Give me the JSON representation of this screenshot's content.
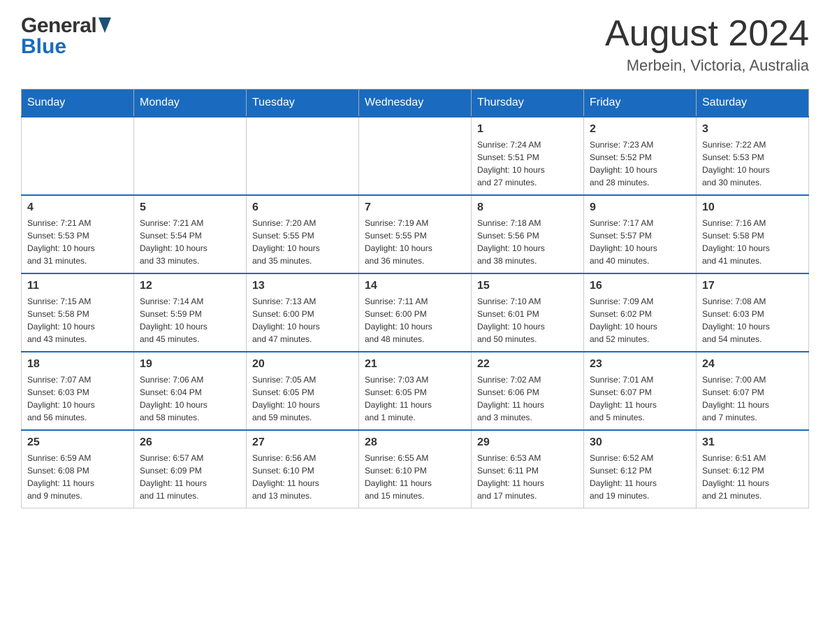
{
  "header": {
    "logo_general": "General",
    "logo_blue": "Blue",
    "title": "August 2024",
    "location": "Merbein, Victoria, Australia"
  },
  "days_of_week": [
    "Sunday",
    "Monday",
    "Tuesday",
    "Wednesday",
    "Thursday",
    "Friday",
    "Saturday"
  ],
  "weeks": [
    [
      {
        "day": "",
        "info": ""
      },
      {
        "day": "",
        "info": ""
      },
      {
        "day": "",
        "info": ""
      },
      {
        "day": "",
        "info": ""
      },
      {
        "day": "1",
        "info": "Sunrise: 7:24 AM\nSunset: 5:51 PM\nDaylight: 10 hours\nand 27 minutes."
      },
      {
        "day": "2",
        "info": "Sunrise: 7:23 AM\nSunset: 5:52 PM\nDaylight: 10 hours\nand 28 minutes."
      },
      {
        "day": "3",
        "info": "Sunrise: 7:22 AM\nSunset: 5:53 PM\nDaylight: 10 hours\nand 30 minutes."
      }
    ],
    [
      {
        "day": "4",
        "info": "Sunrise: 7:21 AM\nSunset: 5:53 PM\nDaylight: 10 hours\nand 31 minutes."
      },
      {
        "day": "5",
        "info": "Sunrise: 7:21 AM\nSunset: 5:54 PM\nDaylight: 10 hours\nand 33 minutes."
      },
      {
        "day": "6",
        "info": "Sunrise: 7:20 AM\nSunset: 5:55 PM\nDaylight: 10 hours\nand 35 minutes."
      },
      {
        "day": "7",
        "info": "Sunrise: 7:19 AM\nSunset: 5:55 PM\nDaylight: 10 hours\nand 36 minutes."
      },
      {
        "day": "8",
        "info": "Sunrise: 7:18 AM\nSunset: 5:56 PM\nDaylight: 10 hours\nand 38 minutes."
      },
      {
        "day": "9",
        "info": "Sunrise: 7:17 AM\nSunset: 5:57 PM\nDaylight: 10 hours\nand 40 minutes."
      },
      {
        "day": "10",
        "info": "Sunrise: 7:16 AM\nSunset: 5:58 PM\nDaylight: 10 hours\nand 41 minutes."
      }
    ],
    [
      {
        "day": "11",
        "info": "Sunrise: 7:15 AM\nSunset: 5:58 PM\nDaylight: 10 hours\nand 43 minutes."
      },
      {
        "day": "12",
        "info": "Sunrise: 7:14 AM\nSunset: 5:59 PM\nDaylight: 10 hours\nand 45 minutes."
      },
      {
        "day": "13",
        "info": "Sunrise: 7:13 AM\nSunset: 6:00 PM\nDaylight: 10 hours\nand 47 minutes."
      },
      {
        "day": "14",
        "info": "Sunrise: 7:11 AM\nSunset: 6:00 PM\nDaylight: 10 hours\nand 48 minutes."
      },
      {
        "day": "15",
        "info": "Sunrise: 7:10 AM\nSunset: 6:01 PM\nDaylight: 10 hours\nand 50 minutes."
      },
      {
        "day": "16",
        "info": "Sunrise: 7:09 AM\nSunset: 6:02 PM\nDaylight: 10 hours\nand 52 minutes."
      },
      {
        "day": "17",
        "info": "Sunrise: 7:08 AM\nSunset: 6:03 PM\nDaylight: 10 hours\nand 54 minutes."
      }
    ],
    [
      {
        "day": "18",
        "info": "Sunrise: 7:07 AM\nSunset: 6:03 PM\nDaylight: 10 hours\nand 56 minutes."
      },
      {
        "day": "19",
        "info": "Sunrise: 7:06 AM\nSunset: 6:04 PM\nDaylight: 10 hours\nand 58 minutes."
      },
      {
        "day": "20",
        "info": "Sunrise: 7:05 AM\nSunset: 6:05 PM\nDaylight: 10 hours\nand 59 minutes."
      },
      {
        "day": "21",
        "info": "Sunrise: 7:03 AM\nSunset: 6:05 PM\nDaylight: 11 hours\nand 1 minute."
      },
      {
        "day": "22",
        "info": "Sunrise: 7:02 AM\nSunset: 6:06 PM\nDaylight: 11 hours\nand 3 minutes."
      },
      {
        "day": "23",
        "info": "Sunrise: 7:01 AM\nSunset: 6:07 PM\nDaylight: 11 hours\nand 5 minutes."
      },
      {
        "day": "24",
        "info": "Sunrise: 7:00 AM\nSunset: 6:07 PM\nDaylight: 11 hours\nand 7 minutes."
      }
    ],
    [
      {
        "day": "25",
        "info": "Sunrise: 6:59 AM\nSunset: 6:08 PM\nDaylight: 11 hours\nand 9 minutes."
      },
      {
        "day": "26",
        "info": "Sunrise: 6:57 AM\nSunset: 6:09 PM\nDaylight: 11 hours\nand 11 minutes."
      },
      {
        "day": "27",
        "info": "Sunrise: 6:56 AM\nSunset: 6:10 PM\nDaylight: 11 hours\nand 13 minutes."
      },
      {
        "day": "28",
        "info": "Sunrise: 6:55 AM\nSunset: 6:10 PM\nDaylight: 11 hours\nand 15 minutes."
      },
      {
        "day": "29",
        "info": "Sunrise: 6:53 AM\nSunset: 6:11 PM\nDaylight: 11 hours\nand 17 minutes."
      },
      {
        "day": "30",
        "info": "Sunrise: 6:52 AM\nSunset: 6:12 PM\nDaylight: 11 hours\nand 19 minutes."
      },
      {
        "day": "31",
        "info": "Sunrise: 6:51 AM\nSunset: 6:12 PM\nDaylight: 11 hours\nand 21 minutes."
      }
    ]
  ]
}
